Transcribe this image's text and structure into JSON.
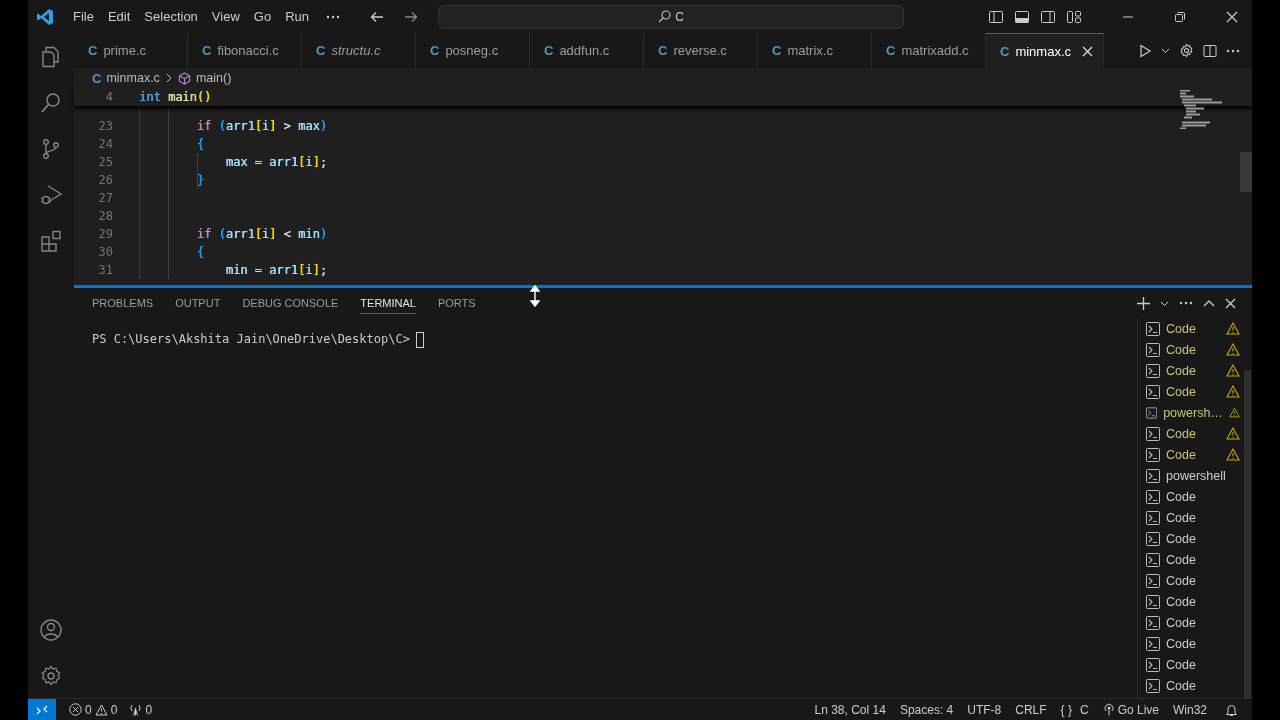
{
  "title_bar": {
    "menu": [
      "File",
      "Edit",
      "Selection",
      "View",
      "Go",
      "Run"
    ],
    "search": {
      "value": "C"
    }
  },
  "tabs": [
    {
      "icon": "C",
      "label": "prime.c",
      "selected": false,
      "preview": false
    },
    {
      "icon": "C",
      "label": "fibonacci.c",
      "selected": false,
      "preview": false
    },
    {
      "icon": "C",
      "label": "structu.c",
      "selected": false,
      "preview": true
    },
    {
      "icon": "C",
      "label": "posneg.c",
      "selected": false,
      "preview": false
    },
    {
      "icon": "C",
      "label": "addfun.c",
      "selected": false,
      "preview": false
    },
    {
      "icon": "C",
      "label": "reverse.c",
      "selected": false,
      "preview": false
    },
    {
      "icon": "C",
      "label": "matrix.c",
      "selected": false,
      "preview": false
    },
    {
      "icon": "C",
      "label": "matrixadd.c",
      "selected": false,
      "preview": false
    },
    {
      "icon": "C",
      "label": "minmax.c",
      "selected": true,
      "preview": false
    }
  ],
  "breadcrumb": {
    "icon": "C",
    "file": "minmax.c",
    "symbol": "main()"
  },
  "sticky_line": {
    "number": "4",
    "tokens": [
      {
        "t": "int ",
        "color": "#569cd6"
      },
      {
        "t": "main",
        "color": "#dcdcaa"
      },
      {
        "t": "()",
        "color": "#ffd700"
      }
    ]
  },
  "code_lines": [
    {
      "number": "23",
      "tokens": [
        {
          "t": "        if ",
          "color": "#c586c0"
        },
        {
          "t": "(",
          "color": "#179fff"
        },
        {
          "t": "arr1",
          "color": "#9cdcfe"
        },
        {
          "t": "[",
          "color": "#ffd700"
        },
        {
          "t": "i",
          "color": "#9cdcfe"
        },
        {
          "t": "]",
          "color": "#ffd700"
        },
        {
          "t": " > ",
          "color": "#d4d4d4"
        },
        {
          "t": "max",
          "color": "#9cdcfe"
        },
        {
          "t": ")",
          "color": "#179fff"
        }
      ]
    },
    {
      "number": "24",
      "tokens": [
        {
          "t": "        {",
          "color": "#179fff"
        }
      ]
    },
    {
      "number": "25",
      "tokens": [
        {
          "t": "            max",
          "color": "#9cdcfe"
        },
        {
          "t": " = ",
          "color": "#d4d4d4"
        },
        {
          "t": "arr1",
          "color": "#9cdcfe"
        },
        {
          "t": "[",
          "color": "#ffd700"
        },
        {
          "t": "i",
          "color": "#9cdcfe"
        },
        {
          "t": "]",
          "color": "#ffd700"
        },
        {
          "t": ";",
          "color": "#d4d4d4"
        }
      ]
    },
    {
      "number": "26",
      "tokens": [
        {
          "t": "        }",
          "color": "#179fff"
        }
      ]
    },
    {
      "number": "27"
    },
    {
      "number": "28"
    },
    {
      "number": "29",
      "tokens": [
        {
          "t": "        if ",
          "color": "#c586c0"
        },
        {
          "t": "(",
          "color": "#179fff"
        },
        {
          "t": "arr1",
          "color": "#9cdcfe"
        },
        {
          "t": "[",
          "color": "#ffd700"
        },
        {
          "t": "i",
          "color": "#9cdcfe"
        },
        {
          "t": "]",
          "color": "#ffd700"
        },
        {
          "t": " < ",
          "color": "#d4d4d4"
        },
        {
          "t": "min",
          "color": "#9cdcfe"
        },
        {
          "t": ")",
          "color": "#179fff"
        }
      ]
    },
    {
      "number": "30",
      "tokens": [
        {
          "t": "        {",
          "color": "#179fff"
        }
      ]
    },
    {
      "number": "31",
      "tokens": [
        {
          "t": "            min",
          "color": "#9cdcfe"
        },
        {
          "t": " = ",
          "color": "#d4d4d4"
        },
        {
          "t": "arr1",
          "color": "#9cdcfe"
        },
        {
          "t": "[",
          "color": "#ffd700"
        },
        {
          "t": "i",
          "color": "#9cdcfe"
        },
        {
          "t": "]",
          "color": "#ffd700"
        },
        {
          "t": ";",
          "color": "#d4d4d4"
        }
      ]
    }
  ],
  "panel": {
    "tabs": [
      {
        "label": "PROBLEMS",
        "selected": false
      },
      {
        "label": "OUTPUT",
        "selected": false
      },
      {
        "label": "DEBUG CONSOLE",
        "selected": false
      },
      {
        "label": "TERMINAL",
        "selected": true
      },
      {
        "label": "PORTS",
        "selected": false
      }
    ],
    "terminal": {
      "prompt": "PS C:\\Users\\Akshita Jain\\OneDrive\\Desktop\\C>"
    },
    "terminal_list": [
      {
        "name": "Code",
        "warning": true
      },
      {
        "name": "Code",
        "warning": true
      },
      {
        "name": "Code",
        "warning": true
      },
      {
        "name": "Code",
        "warning": true
      },
      {
        "name": "powersh…",
        "warning": true
      },
      {
        "name": "Code",
        "warning": true
      },
      {
        "name": "Code",
        "warning": true
      },
      {
        "name": "powershell",
        "warning": false
      },
      {
        "name": "Code",
        "warning": false
      },
      {
        "name": "Code",
        "warning": false
      },
      {
        "name": "Code",
        "warning": false
      },
      {
        "name": "Code",
        "warning": false
      },
      {
        "name": "Code",
        "warning": false
      },
      {
        "name": "Code",
        "warning": false
      },
      {
        "name": "Code",
        "warning": false
      },
      {
        "name": "Code",
        "warning": false
      },
      {
        "name": "Code",
        "warning": false
      },
      {
        "name": "Code",
        "warning": false
      }
    ]
  },
  "status_bar": {
    "errors": "0",
    "warnings": "0",
    "ports": "0",
    "items": [
      "Ln 38, Col 14",
      "Spaces: 4",
      "UTF-8",
      "CRLF"
    ],
    "language_braces": "{ }",
    "language": "C",
    "go_live": "Go Live",
    "platform": "Win32"
  }
}
